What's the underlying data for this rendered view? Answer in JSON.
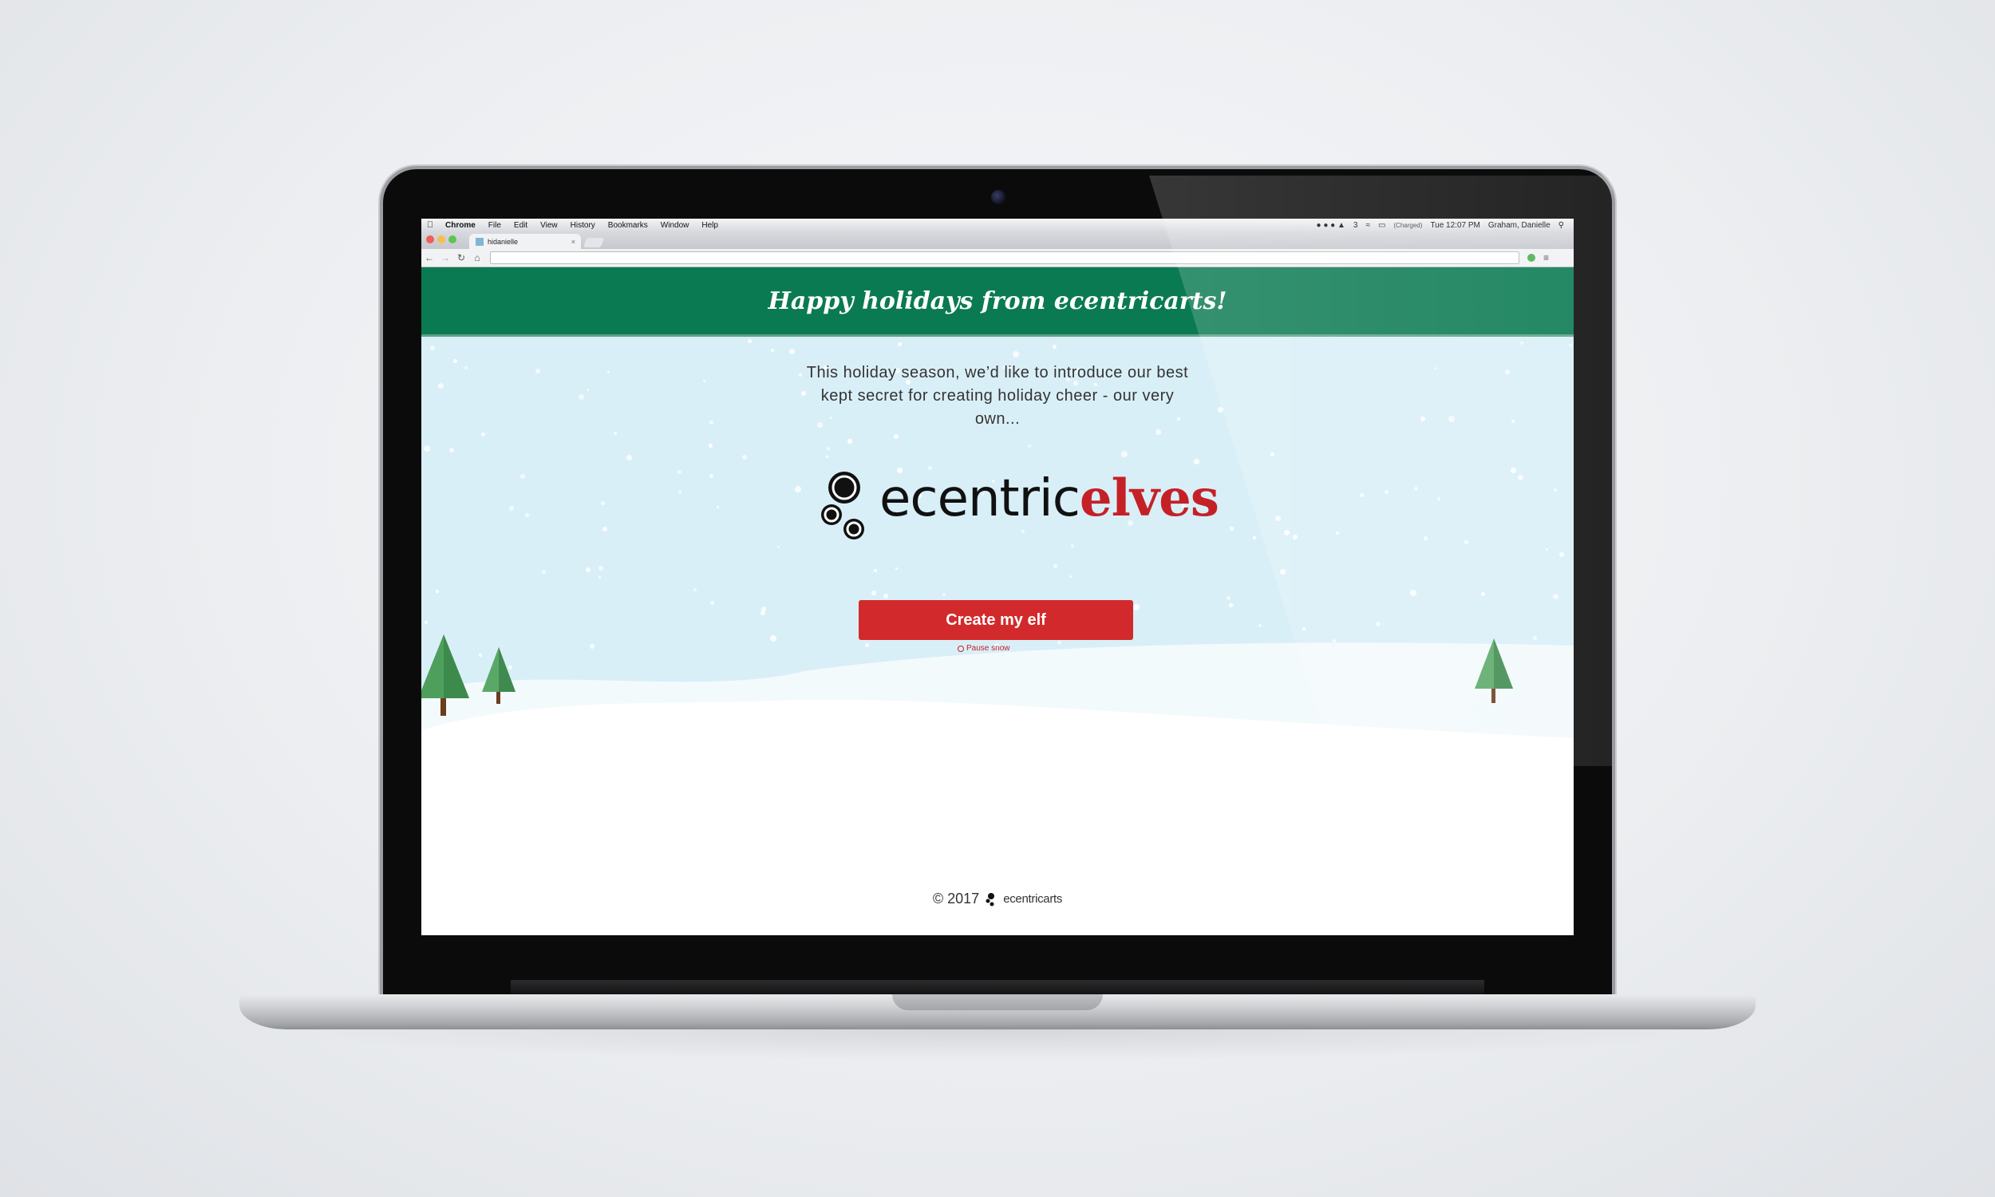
{
  "menubar": {
    "items": [
      "Chrome",
      "File",
      "Edit",
      "View",
      "History",
      "Bookmarks",
      "Window",
      "Help"
    ],
    "status": {
      "badge_count": "3",
      "battery": "(Charged)",
      "clock": "Tue 12:07 PM",
      "user": "Graham, Danielle"
    }
  },
  "browser": {
    "tab_title": "hidanielle",
    "url": ""
  },
  "page": {
    "banner_title": "Happy holidays from ecentricarts!",
    "intro_text": "This holiday season, we’d like to introduce our best kept secret for creating holiday cheer - our very own...",
    "logo_wordmark_main": "ecentric",
    "logo_wordmark_accent": "elves",
    "cta_label": "Create my elf",
    "pause_snow_label": "Pause snow",
    "footer_copyright": "© 2017",
    "footer_brand": "ecentricarts"
  },
  "colors": {
    "banner": "#0a7a52",
    "sky": "#d9eff7",
    "cta": "#d22a2c",
    "accent_red": "#c42127"
  },
  "icons": [
    "apple-icon",
    "back-icon",
    "forward-icon",
    "reload-icon",
    "home-icon",
    "wifi-icon",
    "battery-icon",
    "spotlight-icon",
    "chrome-menu-icon"
  ]
}
